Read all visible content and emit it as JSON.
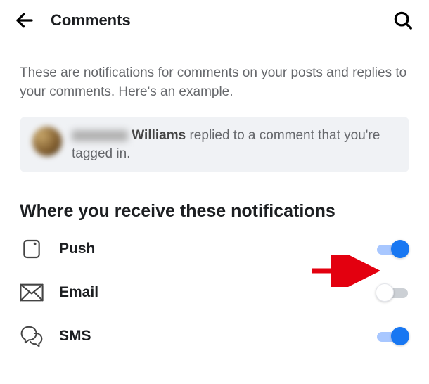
{
  "header": {
    "title": "Comments"
  },
  "description": "These are notifications for comments on your posts and replies to your comments. Here's an example.",
  "example": {
    "last_name": "Williams",
    "action_text": "replied to a comment that you're tagged in."
  },
  "section_title": "Where you receive these notifications",
  "options": {
    "push": {
      "label": "Push",
      "on": true
    },
    "email": {
      "label": "Email",
      "on": false
    },
    "sms": {
      "label": "SMS",
      "on": true
    }
  }
}
